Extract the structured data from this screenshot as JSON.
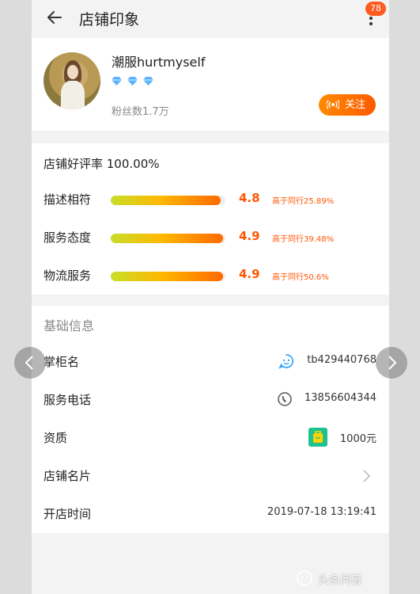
{
  "header": {
    "title": "店铺印象",
    "badge_count": "78"
  },
  "shop": {
    "name": "潮服hurtmyself",
    "diamond_count": 3,
    "fans": "粉丝数1.7万",
    "follow_label": "关注",
    "colors": {
      "accent": "#ff6a00",
      "diamond": "#5ab4ff"
    }
  },
  "ratings": {
    "title": "店铺好评率 100.00%",
    "rows": [
      {
        "label": "描述相符",
        "score": "4.8",
        "compare": "高于同行25.89%",
        "fill": 0.96
      },
      {
        "label": "服务态度",
        "score": "4.9",
        "compare": "高于同行39.48%",
        "fill": 0.98
      },
      {
        "label": "物流服务",
        "score": "4.9",
        "compare": "高于同行50.6%",
        "fill": 0.98
      }
    ]
  },
  "basic_info": {
    "title": "基础信息",
    "rows": [
      {
        "label": "掌柜名",
        "value": "tb429440768",
        "icon": "chat-icon"
      },
      {
        "label": "服务电话",
        "value": "13856604344",
        "icon": "phone-icon"
      },
      {
        "label": "资质",
        "value": "1000元",
        "icon": "bag-icon"
      },
      {
        "label": "店铺名片",
        "value": "",
        "icon": "chevron-right-icon"
      },
      {
        "label": "开店时间",
        "value": "2019-07-18 13:19:41",
        "icon": ""
      }
    ]
  },
  "watermark": {
    "text": "头条问答"
  }
}
